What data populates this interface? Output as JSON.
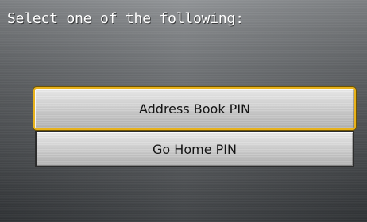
{
  "screen": {
    "prompt": "Select one of the following:"
  },
  "menu": {
    "items": [
      {
        "label": "Address Book PIN",
        "selected": true
      },
      {
        "label": "Go Home PIN",
        "selected": false
      }
    ]
  },
  "colors": {
    "selection_border": "#e8b21c",
    "button_text": "#141414",
    "prompt_text": "#ffffff"
  }
}
